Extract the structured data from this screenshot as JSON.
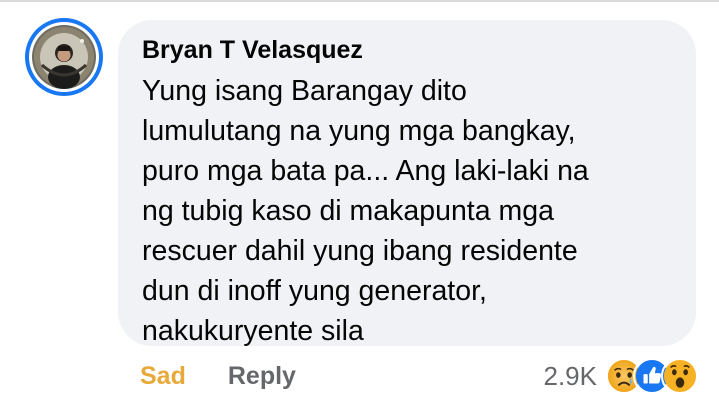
{
  "comment": {
    "author": "Bryan T Velasquez",
    "avatar_icon": "profile-photo-icon",
    "body_lines": [
      "Yung isang Barangay dito",
      "lumulutang na yung mga bangkay,",
      "puro mga bata pa... Ang laki-laki na",
      "ng tubig kaso di makapunta mga",
      "rescuer dahil yung ibang residente",
      "dun di inoff yung generator,",
      "nakukuryente  sila"
    ]
  },
  "actions": {
    "sad_label": "Sad",
    "reply_label": "Reply"
  },
  "reactions": {
    "count": "2.9K",
    "icons": [
      "sad-emoji-icon",
      "like-icon",
      "wow-emoji-icon"
    ]
  },
  "colors": {
    "bubble": "#f0f2f5",
    "sad": "#e8a93b",
    "secondary_text": "#65676b",
    "avatar_ring": "#1877f2"
  }
}
